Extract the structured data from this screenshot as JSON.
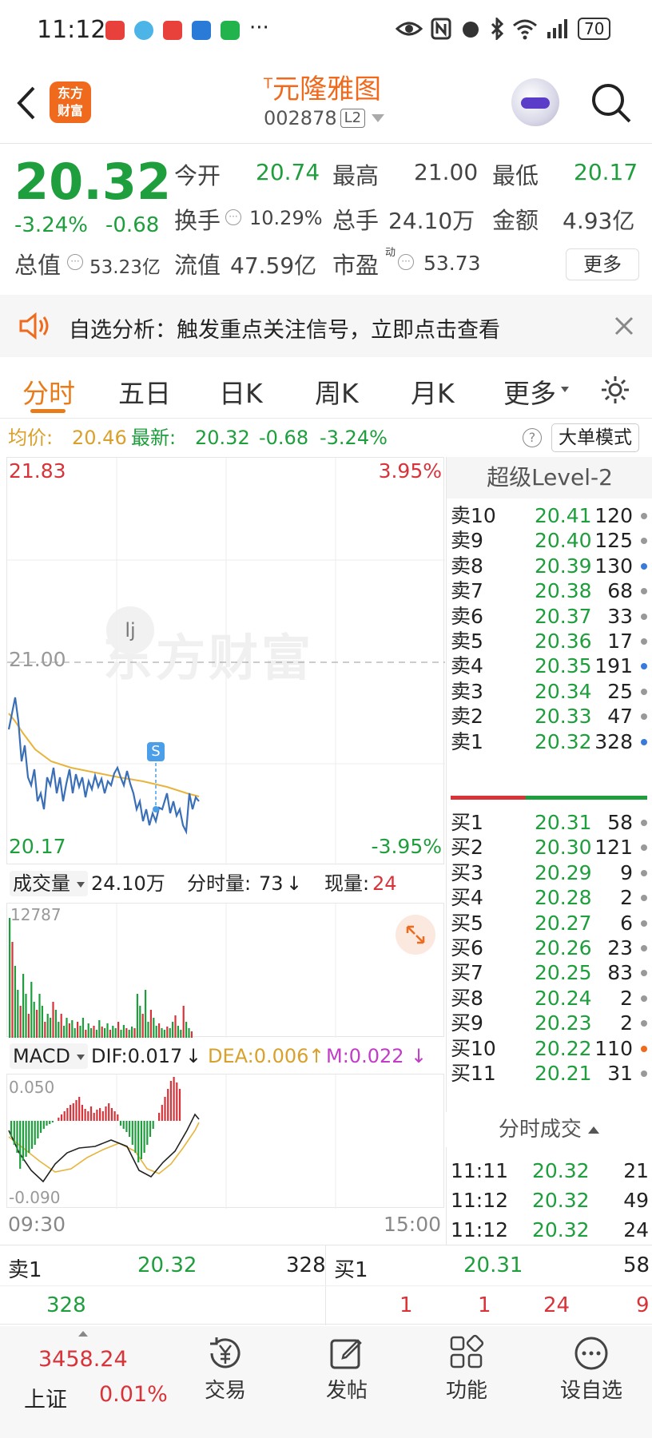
{
  "status_bar": {
    "time": "11:12",
    "more": "···",
    "battery": "70",
    "network": "4G"
  },
  "header": {
    "back_icon": "chevron-left-icon",
    "logo_line1": "东方",
    "logo_line2": "财富",
    "stock_name": "元隆雅图",
    "stock_prefix": "T",
    "stock_code": "002878",
    "level_badge": "L2",
    "search_icon": "search-icon"
  },
  "quote": {
    "price": "20.32",
    "change_pct": "-3.24%",
    "change": "-0.68",
    "open_label": "今开",
    "open": "20.74",
    "high_label": "最高",
    "high": "21.00",
    "low_label": "最低",
    "low": "20.17",
    "turnover_label": "换手",
    "turnover": "10.29%",
    "volume_label": "总手",
    "volume": "24.10万",
    "amount_label": "金额",
    "amount": "4.93亿",
    "mktcap_label": "总值",
    "mktcap": "53.23亿",
    "float_label": "流值",
    "float": "47.59亿",
    "pe_label": "市盈",
    "pe_sup": "动",
    "pe": "53.73",
    "more_button": "更多"
  },
  "notice": {
    "text": "自选分析：触发重点关注信号，立即点击查看"
  },
  "tabs": [
    {
      "label": "分时"
    },
    {
      "label": "五日"
    },
    {
      "label": "日K"
    },
    {
      "label": "周K"
    },
    {
      "label": "月K"
    },
    {
      "label": "更多"
    }
  ],
  "info_bar": {
    "avg_label": "均价:",
    "avg": "20.46",
    "latest_label": "最新:",
    "latest": "20.32",
    "chg": "-0.68",
    "pct": "-3.24%",
    "mode_button": "大单模式"
  },
  "chart": {
    "price_top": "21.83",
    "pct_top": "3.95%",
    "ref_price": "21.00",
    "price_bottom": "20.17",
    "pct_bottom": "-3.95%",
    "watermark": "东方财富",
    "marker": "S",
    "wm_letter": "lj",
    "time_start": "09:30",
    "time_end": "15:00"
  },
  "volume_bar": {
    "label": "成交量",
    "total": "24.10万",
    "tick_label": "分时量:",
    "tick_value": "73",
    "current_label": "现量:",
    "current_value": "24",
    "max": "12787"
  },
  "macd_bar": {
    "label": "MACD",
    "dif": "DIF:0.017",
    "dea": "DEA:0.006",
    "m": "M:0.022",
    "top": "0.050",
    "bottom": "-0.090"
  },
  "level2": {
    "title": "超级Level-2",
    "asks": [
      {
        "label": "卖10",
        "price": "20.41",
        "vol": "120"
      },
      {
        "label": "卖9",
        "price": "20.40",
        "vol": "125"
      },
      {
        "label": "卖8",
        "price": "20.39",
        "vol": "130"
      },
      {
        "label": "卖7",
        "price": "20.38",
        "vol": "68"
      },
      {
        "label": "卖6",
        "price": "20.37",
        "vol": "33"
      },
      {
        "label": "卖5",
        "price": "20.36",
        "vol": "17"
      },
      {
        "label": "卖4",
        "price": "20.35",
        "vol": "191"
      },
      {
        "label": "卖3",
        "price": "20.34",
        "vol": "25"
      },
      {
        "label": "卖2",
        "price": "20.33",
        "vol": "47"
      },
      {
        "label": "卖1",
        "price": "20.32",
        "vol": "328"
      }
    ],
    "bids": [
      {
        "label": "买1",
        "price": "20.31",
        "vol": "58"
      },
      {
        "label": "买2",
        "price": "20.30",
        "vol": "121"
      },
      {
        "label": "买3",
        "price": "20.29",
        "vol": "9"
      },
      {
        "label": "买4",
        "price": "20.28",
        "vol": "2"
      },
      {
        "label": "买5",
        "price": "20.27",
        "vol": "6"
      },
      {
        "label": "买6",
        "price": "20.26",
        "vol": "23"
      },
      {
        "label": "买7",
        "price": "20.25",
        "vol": "83"
      },
      {
        "label": "买8",
        "price": "20.24",
        "vol": "2"
      },
      {
        "label": "买9",
        "price": "20.23",
        "vol": "2"
      },
      {
        "label": "买10",
        "price": "20.22",
        "vol": "110"
      },
      {
        "label": "买11",
        "price": "20.21",
        "vol": "31"
      }
    ],
    "trades_title": "分时成交",
    "trades": [
      {
        "time": "11:11",
        "price": "20.32",
        "vol": "21"
      },
      {
        "time": "11:12",
        "price": "20.32",
        "vol": "49"
      },
      {
        "time": "11:12",
        "price": "20.32",
        "vol": "24"
      }
    ]
  },
  "bottom_quote": {
    "sell_label": "卖1",
    "sell_price": "20.32",
    "sell_vol": "328",
    "buy_label": "买1",
    "buy_price": "20.31",
    "buy_vol": "58",
    "sell_queue": [
      "328"
    ],
    "buy_queue": [
      "1",
      "1",
      "24",
      "9"
    ]
  },
  "nav": {
    "index_value": "3458.24",
    "index_name": "上证",
    "index_pct": "0.01%",
    "items": [
      {
        "label": "交易",
        "icon": "yen-cycle-icon"
      },
      {
        "label": "发帖",
        "icon": "edit-icon"
      },
      {
        "label": "功能",
        "icon": "grid-icon"
      },
      {
        "label": "设自选",
        "icon": "more-circle-icon"
      }
    ]
  }
}
